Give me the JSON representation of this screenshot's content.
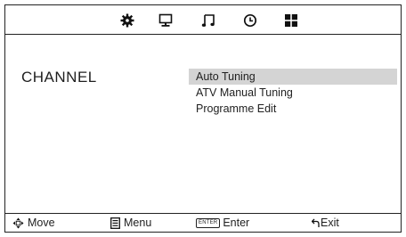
{
  "tabs": [
    {
      "icon": "gear-icon",
      "label": ""
    },
    {
      "icon": "monitor-icon",
      "label": ""
    },
    {
      "icon": "music-note-icon",
      "label": ""
    },
    {
      "icon": "clock-icon",
      "label": ""
    },
    {
      "icon": "grid-icon",
      "label": ""
    }
  ],
  "section": {
    "title": "CHANNEL"
  },
  "menu": {
    "items": [
      {
        "label": "Auto Tuning",
        "selected": true
      },
      {
        "label": "ATV Manual Tuning",
        "selected": false
      },
      {
        "label": "Programme Edit",
        "selected": false
      }
    ]
  },
  "footer": {
    "move_label": "Move",
    "menu_label": "Menu",
    "enter_key_label": "ENTER",
    "enter_label": "Enter",
    "exit_label": "Exit"
  },
  "colors": {
    "selection_highlight": "#d4d4d4",
    "border": "#222222",
    "text": "#1f1f1f"
  }
}
